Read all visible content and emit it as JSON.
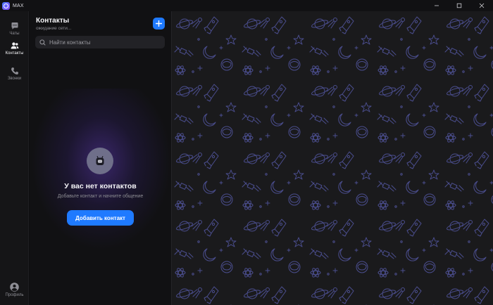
{
  "window": {
    "title": "MAX"
  },
  "rail": {
    "items": [
      {
        "label": "Чаты",
        "icon": "chat-bubble-icon",
        "active": false
      },
      {
        "label": "Контакты",
        "icon": "contacts-icon",
        "active": true
      },
      {
        "label": "Звонки",
        "icon": "phone-icon",
        "active": false
      }
    ],
    "profile": {
      "label": "Профиль",
      "icon": "profile-avatar-icon"
    }
  },
  "contacts": {
    "title": "Контакты",
    "status": "ожидание сети...",
    "add_icon": "plus-icon",
    "search": {
      "placeholder": "Найти контакты",
      "value": ""
    },
    "empty": {
      "title": "У вас нет контактов",
      "subtitle": "Добавьте контакт и начните общение",
      "button": "Добавить контакт",
      "icon": "robot-face-icon"
    }
  },
  "colors": {
    "accent": "#1f7aff",
    "panel_bg": "#111113",
    "chat_bg": "#1a1a1c",
    "pattern": "#4a4d8e",
    "glow": "#5a37af"
  }
}
